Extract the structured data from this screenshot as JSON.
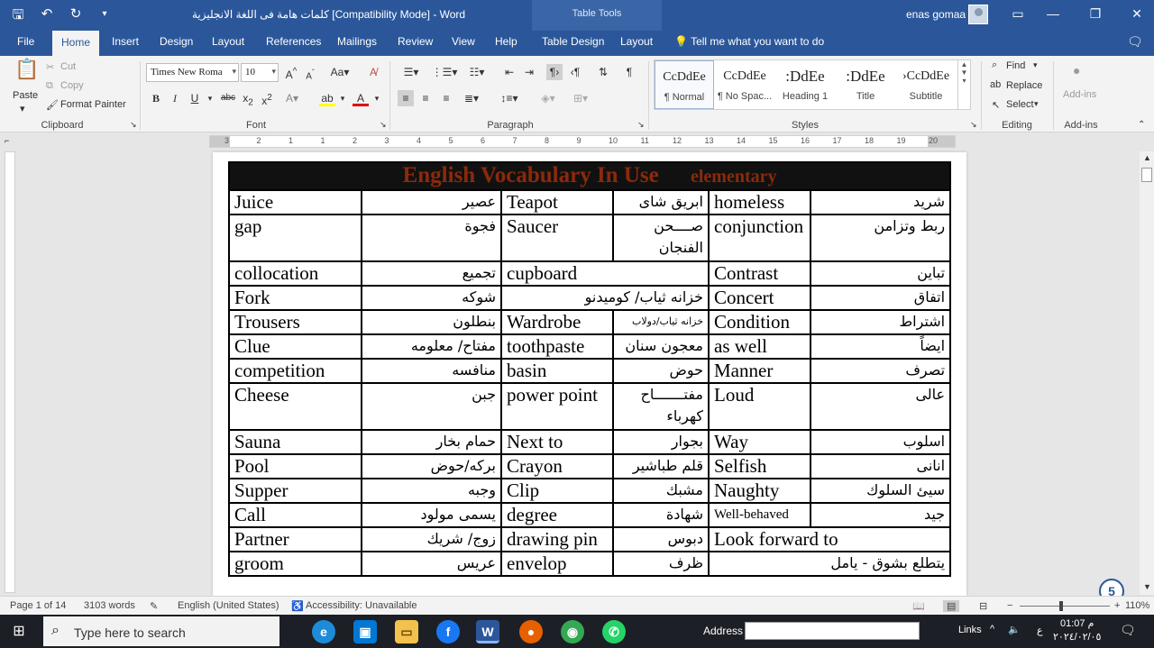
{
  "titlebar": {
    "doc_title": "كلمات هامة فى اللغة الانجليزية [Compatibility Mode]  -  Word",
    "context_label": "Table Tools",
    "user": "enas gomaa",
    "qat": [
      "save-icon",
      "undo-icon",
      "redo-icon",
      "customize-icon"
    ]
  },
  "tabs": [
    "File",
    "Home",
    "Insert",
    "Design",
    "Layout",
    "References",
    "Mailings",
    "Review",
    "View",
    "Help",
    "Table Design",
    "Layout"
  ],
  "tell_me": "Tell me what you want to do",
  "ribbon": {
    "clipboard": {
      "paste": "Paste",
      "cut": "Cut",
      "copy": "Copy",
      "format_painter": "Format Painter",
      "label": "Clipboard"
    },
    "font": {
      "name": "Times New Roma",
      "size": "10",
      "label": "Font"
    },
    "paragraph": {
      "label": "Paragraph"
    },
    "styles": {
      "label": "Styles",
      "items": [
        {
          "sample": "CcDdEe",
          "name": "¶ Normal"
        },
        {
          "sample": "CcDdEe",
          "name": "¶ No Spac..."
        },
        {
          "sample": ":DdEe",
          "name": "Heading 1"
        },
        {
          "sample": ":DdEe",
          "name": "Title"
        },
        {
          "sample": "›CcDdEe",
          "name": "Subtitle"
        }
      ]
    },
    "editing": {
      "find": "Find",
      "replace": "Replace",
      "select": "Select",
      "label": "Editing"
    },
    "addins": {
      "button": "Add-ins",
      "label": "Add-ins"
    }
  },
  "ruler": [
    "3",
    "2",
    "1",
    "1",
    "2",
    "3",
    "4",
    "5",
    "6",
    "7",
    "8",
    "9",
    "10",
    "11",
    "12",
    "13",
    "14",
    "15",
    "16",
    "17",
    "18",
    "19",
    "20"
  ],
  "document": {
    "title_main": "English Vocabulary In Use",
    "title_sub": "elementary",
    "rows": [
      {
        "c": [
          "Juice",
          "عصير",
          "Teapot",
          "ابريق شاى",
          "homeless",
          "شريد"
        ]
      },
      {
        "c": [
          "gap",
          "فجوة",
          "Saucer",
          "صــــحن الفنجان",
          "conjunction",
          "ربط وتزامن"
        ],
        "tall": true
      },
      {
        "c": [
          "collocation",
          "تجميع",
          "cupboard",
          "Contrast",
          "تباين"
        ],
        "merge": "c"
      },
      {
        "c": [
          "Fork",
          "شوكه",
          "خزانه ثياب/ كوميدنو",
          "Concert",
          "اتفاق"
        ],
        "merge": "d"
      },
      {
        "c": [
          "Trousers",
          "بنطلون",
          "Wardrobe",
          "خزانه ثياب/دولاب",
          "Condition",
          "اشتراط"
        ]
      },
      {
        "c": [
          "Clue",
          "مفتاح/ معلومه",
          "toothpaste",
          "معجون سنان",
          "as well",
          "ايضاً"
        ]
      },
      {
        "c": [
          "competition",
          "منافسه",
          "basin",
          "حوض",
          "Manner",
          "تصرف"
        ]
      },
      {
        "c": [
          "Cheese",
          "جبن",
          "power point",
          "مفتـــــــاح كهرباء",
          "Loud",
          "عالى"
        ],
        "tall": true
      },
      {
        "c": [
          "Sauna",
          "حمام بخار",
          "Next to",
          "بجوار",
          "Way",
          "اسلوب"
        ]
      },
      {
        "c": [
          "Pool",
          "بركه/حوض",
          "Crayon",
          "قلم طباشير",
          "Selfish",
          "انانى"
        ]
      },
      {
        "c": [
          "Supper",
          "وجبه",
          "Clip",
          "مشبك",
          "Naughty",
          "سيئ السلوك"
        ]
      },
      {
        "c": [
          "Call",
          "يسمى مولود",
          "degree",
          "شهادة",
          "Well-behaved",
          "جيد"
        ]
      },
      {
        "c": [
          "Partner",
          "زوج/ شريك",
          "drawing  pin",
          "دبوس",
          "Look forward to"
        ],
        "merge": "e"
      },
      {
        "c": [
          "groom",
          "عريس",
          "envelop",
          "ظرف",
          "يتطلع بشوق - يامل"
        ],
        "merge": "f"
      }
    ]
  },
  "statusbar": {
    "page": "Page 1 of 14",
    "words": "3103 words",
    "language": "English (United States)",
    "accessibility": "Accessibility: Unavailable",
    "zoom": "110%"
  },
  "taskbar": {
    "search_placeholder": "Type here to search",
    "address_label": "Address",
    "links": "Links",
    "lang": "ع",
    "time": "01:07 م",
    "date": "٢٠٢٤/٠٢/٠٥"
  },
  "badge": "5"
}
